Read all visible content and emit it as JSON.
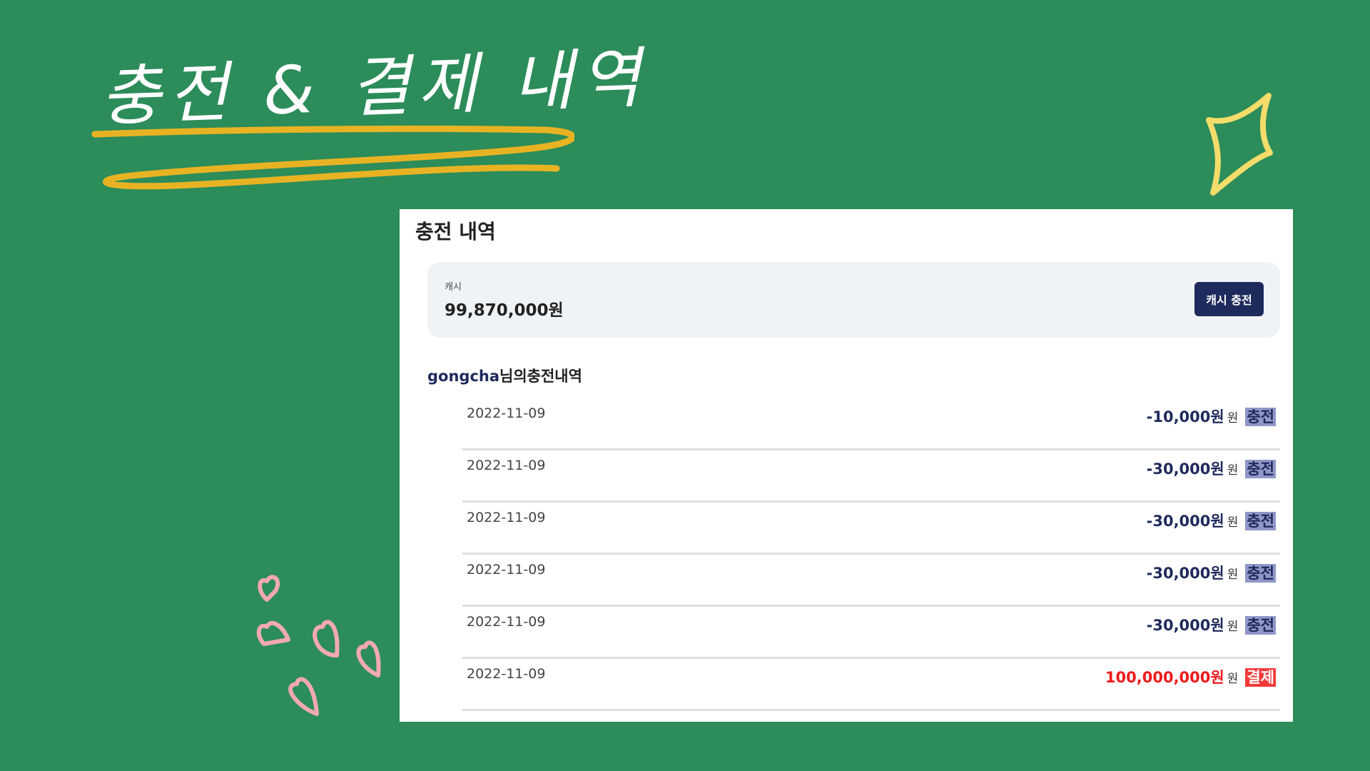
{
  "slide": {
    "title": "충전 & 결제 내역"
  },
  "panel": {
    "title": "충전 내역",
    "cash": {
      "label": "캐시",
      "amount": "99,870,000원",
      "button_label": "캐시 충전"
    },
    "history": {
      "user": "gongcha",
      "suffix": "님의충전내역"
    },
    "rows": [
      {
        "date": "2022-11-09",
        "amount": "-10,000원",
        "unit": "원",
        "badge": "충전",
        "kind": "charge"
      },
      {
        "date": "2022-11-09",
        "amount": "-30,000원",
        "unit": "원",
        "badge": "충전",
        "kind": "charge"
      },
      {
        "date": "2022-11-09",
        "amount": "-30,000원",
        "unit": "원",
        "badge": "충전",
        "kind": "charge"
      },
      {
        "date": "2022-11-09",
        "amount": "-30,000원",
        "unit": "원",
        "badge": "충전",
        "kind": "charge"
      },
      {
        "date": "2022-11-09",
        "amount": "-30,000원",
        "unit": "원",
        "badge": "충전",
        "kind": "charge"
      },
      {
        "date": "2022-11-09",
        "amount": "100,000,000원",
        "unit": "원",
        "badge": "결제",
        "kind": "pay"
      }
    ]
  },
  "colors": {
    "background": "#2c8c5a",
    "accent_navy": "#1f2a5c",
    "accent_red": "#ee1b1b",
    "scribble_yellow": "#e8b323",
    "heart_pink": "#f2a9b4"
  },
  "decorations": [
    "underline-scribble",
    "sparkle-icon",
    "heart-icons"
  ]
}
